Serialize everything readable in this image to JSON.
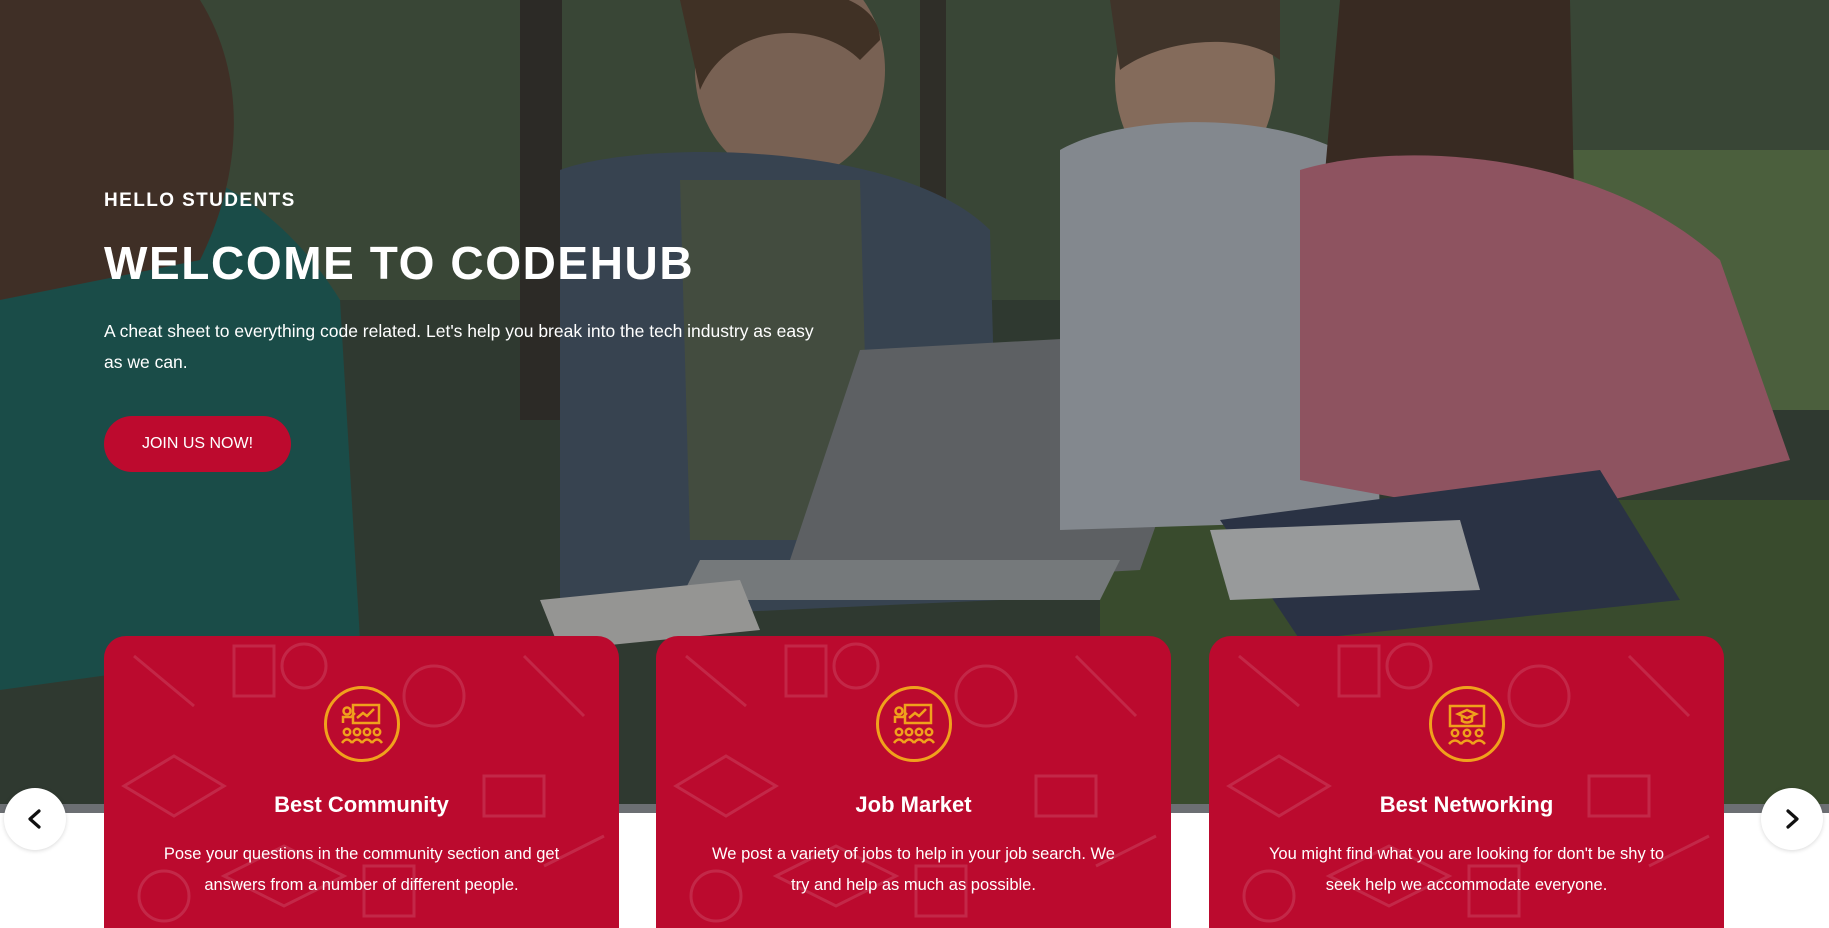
{
  "hero": {
    "eyebrow": "HELLO STUDENTS",
    "headline": "WELCOME TO CODEHUB",
    "subtext": "A cheat sheet to everything code related. Let's help you break into the tech industry as easy as we can.",
    "cta_label": "JOIN US NOW!"
  },
  "features": [
    {
      "title": "Best Community",
      "text": "Pose your questions in the community section and get answers from a number of different people.",
      "icon": "presentation-audience-icon"
    },
    {
      "title": "Job Market",
      "text": "We post a variety of jobs to help in your job search. We try and help as much as possible.",
      "icon": "presentation-audience-icon"
    },
    {
      "title": "Best Networking",
      "text": "You might find what you are looking for don't be shy to seek help we accommodate everyone.",
      "icon": "graduation-board-icon"
    }
  ],
  "carousel": {
    "prev_icon": "chevron-left-icon",
    "next_icon": "chevron-right-icon"
  },
  "colors": {
    "brand_red": "#bd0a2e",
    "icon_gold": "#f0a11c",
    "white": "#ffffff"
  }
}
